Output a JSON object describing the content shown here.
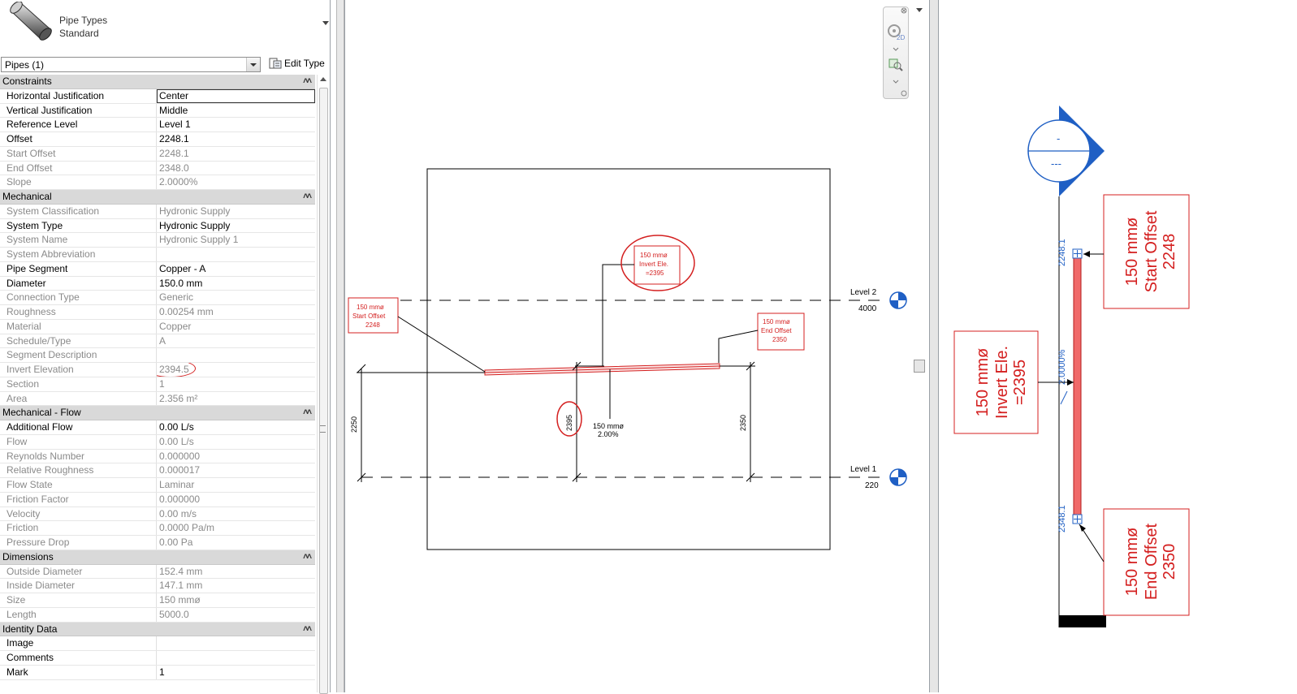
{
  "type_selector": {
    "family": "Pipe Types",
    "type": "Standard"
  },
  "selector": {
    "value": "Pipes (1)",
    "edit_type_label": "Edit Type"
  },
  "groups": [
    {
      "name": "Constraints",
      "rows": [
        {
          "k": "Horizontal Justification",
          "v": "Center",
          "dim": false,
          "sel": true
        },
        {
          "k": "Vertical Justification",
          "v": "Middle",
          "dim": false
        },
        {
          "k": "Reference Level",
          "v": "Level 1",
          "dim": false
        },
        {
          "k": "Offset",
          "v": "2248.1",
          "dim": false
        },
        {
          "k": "Start Offset",
          "v": "2248.1",
          "dim": true
        },
        {
          "k": "End Offset",
          "v": "2348.0",
          "dim": true
        },
        {
          "k": "Slope",
          "v": "2.0000%",
          "dim": true
        }
      ]
    },
    {
      "name": "Mechanical",
      "rows": [
        {
          "k": "System Classification",
          "v": "Hydronic Supply",
          "dim": true
        },
        {
          "k": "System Type",
          "v": "Hydronic Supply",
          "dim": false
        },
        {
          "k": "System Name",
          "v": "Hydronic Supply 1",
          "dim": true
        },
        {
          "k": "System Abbreviation",
          "v": "",
          "dim": true
        },
        {
          "k": "Pipe Segment",
          "v": "Copper - A",
          "dim": false
        },
        {
          "k": "Diameter",
          "v": "150.0 mm",
          "dim": false
        },
        {
          "k": "Connection Type",
          "v": "Generic",
          "dim": true
        },
        {
          "k": "Roughness",
          "v": "0.00254 mm",
          "dim": true
        },
        {
          "k": "Material",
          "v": "Copper",
          "dim": true
        },
        {
          "k": "Schedule/Type",
          "v": "A",
          "dim": true
        },
        {
          "k": "Segment Description",
          "v": "",
          "dim": true
        },
        {
          "k": "Invert Elevation",
          "v": "2394.5",
          "dim": true,
          "circled": true
        },
        {
          "k": "Section",
          "v": "1",
          "dim": true
        },
        {
          "k": "Area",
          "v": "2.356 m²",
          "dim": true
        }
      ]
    },
    {
      "name": "Mechanical - Flow",
      "rows": [
        {
          "k": "Additional Flow",
          "v": "0.00 L/s",
          "dim": false
        },
        {
          "k": "Flow",
          "v": "0.00 L/s",
          "dim": true
        },
        {
          "k": "Reynolds Number",
          "v": "0.000000",
          "dim": true
        },
        {
          "k": "Relative Roughness",
          "v": "0.000017",
          "dim": true
        },
        {
          "k": "Flow State",
          "v": "Laminar",
          "dim": true
        },
        {
          "k": "Friction Factor",
          "v": "0.000000",
          "dim": true
        },
        {
          "k": "Velocity",
          "v": "0.00 m/s",
          "dim": true
        },
        {
          "k": "Friction",
          "v": "0.0000 Pa/m",
          "dim": true
        },
        {
          "k": "Pressure Drop",
          "v": "0.00 Pa",
          "dim": true
        }
      ]
    },
    {
      "name": "Dimensions",
      "rows": [
        {
          "k": "Outside Diameter",
          "v": "152.4 mm",
          "dim": true
        },
        {
          "k": "Inside Diameter",
          "v": "147.1 mm",
          "dim": true
        },
        {
          "k": "Size",
          "v": "150 mmø",
          "dim": true
        },
        {
          "k": "Length",
          "v": "5000.0",
          "dim": true
        }
      ]
    },
    {
      "name": "Identity Data",
      "rows": [
        {
          "k": "Image",
          "v": "",
          "dim": false
        },
        {
          "k": "Comments",
          "v": "",
          "dim": false
        },
        {
          "k": "Mark",
          "v": "1",
          "dim": false
        }
      ]
    }
  ],
  "section_view": {
    "levels": [
      {
        "name": "Level 2",
        "elev": "4000"
      },
      {
        "name": "Level 1",
        "elev": "220"
      }
    ],
    "tag_start": [
      "150 mmø",
      "Start Offset",
      "2248"
    ],
    "tag_invert": [
      "150 mmø",
      "Invert Ele.",
      "=2395"
    ],
    "tag_end": [
      "150 mmø",
      "End Offset",
      "2350"
    ],
    "pipe_tag": [
      "150 mmø",
      "2.00%"
    ],
    "dims": {
      "left": "2250",
      "mid": "2395",
      "right": "2350"
    },
    "nav_2d": "2D"
  },
  "plan_view": {
    "elev_marker_top": "-",
    "elev_marker_bottom": "---",
    "tag_start": [
      "150 mmø",
      "Start Offset",
      "2248"
    ],
    "tag_invert": [
      "150 mmø",
      "Invert Ele.",
      "=2395"
    ],
    "tag_end": [
      "150 mmø",
      "End Offset",
      "2350"
    ],
    "start_label": "2248.1",
    "slope_label": "2.0000%",
    "end_label": "2348.1"
  },
  "colors": {
    "annotation_red": "#d42020",
    "pipe_fill": "#f06a6a",
    "group_bg": "#d9d9d9",
    "level_blue": "#1f5fc4"
  }
}
